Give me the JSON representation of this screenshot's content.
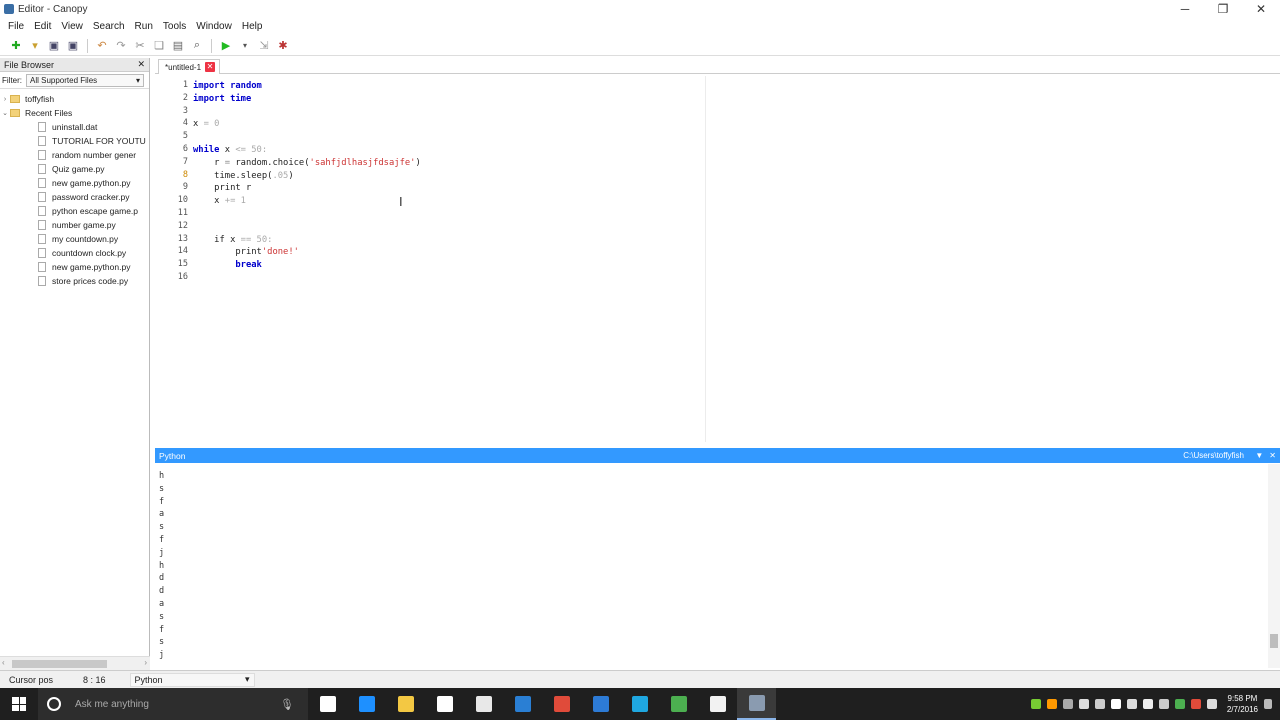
{
  "window": {
    "title": "Editor - Canopy"
  },
  "menu": [
    "File",
    "Edit",
    "View",
    "Search",
    "Run",
    "Tools",
    "Window",
    "Help"
  ],
  "file_browser": {
    "title": "File Browser",
    "filter_label": "Filter:",
    "filter_value": "All Supported Files",
    "root": "toffyfish",
    "recent_label": "Recent Files",
    "files": [
      "uninstall.dat",
      "TUTORIAL FOR YOUTU",
      "random number gener",
      "Quiz game.py",
      "new game.python.py",
      "password cracker.py",
      "python escape game.p",
      "number game.py",
      "my countdown.py",
      "countdown clock.py",
      "new game.python.py",
      "store prices code.py"
    ]
  },
  "editor": {
    "tab_label": "*untitled-1",
    "line_numbers": [
      "1",
      "2",
      "3",
      "4",
      "5",
      "6",
      "7",
      "8",
      "9",
      "10",
      "11",
      "12",
      "13",
      "14",
      "15",
      "16"
    ],
    "lines": [
      [
        {
          "t": "import",
          "c": "kw"
        },
        {
          "t": " "
        },
        {
          "t": "random",
          "c": "kw"
        }
      ],
      [
        {
          "t": "import",
          "c": "kw"
        },
        {
          "t": " "
        },
        {
          "t": "time",
          "c": "kw"
        }
      ],
      [],
      [
        {
          "t": "x "
        },
        {
          "t": "= 0",
          "c": "num"
        }
      ],
      [],
      [
        {
          "t": "while",
          "c": "kw"
        },
        {
          "t": " x "
        },
        {
          "t": "<= 50:",
          "c": "num"
        }
      ],
      [
        {
          "t": "    r "
        },
        {
          "t": "= ",
          "c": "op"
        },
        {
          "t": "random.choice("
        },
        {
          "t": "'sahfjdlhasjfdsajfe'",
          "c": "str"
        },
        {
          "t": ")"
        }
      ],
      [
        {
          "t": "    time.sleep("
        },
        {
          "t": ".05",
          "c": "num"
        },
        {
          "t": ")"
        }
      ],
      [
        {
          "t": "    print r"
        }
      ],
      [
        {
          "t": "    x "
        },
        {
          "t": "+= 1",
          "c": "num"
        }
      ],
      [],
      [],
      [
        {
          "t": "    if x "
        },
        {
          "t": "== 50:",
          "c": "num"
        }
      ],
      [
        {
          "t": "        print"
        },
        {
          "t": "'done!'",
          "c": "str"
        }
      ],
      [
        {
          "t": "        break",
          "c": "kw"
        }
      ],
      []
    ]
  },
  "python_panel": {
    "title": "Python",
    "path": "C:\\Users\\toffyfish",
    "output": [
      "h",
      "s",
      "f",
      "a",
      "s",
      "f",
      "j",
      "h",
      "d",
      "d",
      "a",
      "s",
      "f",
      "s",
      "j"
    ]
  },
  "statusbar": {
    "cursor_label": "Cursor pos",
    "cursor_value": "8 : 16",
    "language": "Python"
  },
  "taskbar": {
    "search_placeholder": "Ask me anything",
    "time": "9:58 PM",
    "date": "2/7/2016",
    "apps": [
      {
        "name": "task-view",
        "color": "#ffffff"
      },
      {
        "name": "edge",
        "color": "#1e90ff"
      },
      {
        "name": "file-explorer",
        "color": "#f3c843"
      },
      {
        "name": "store",
        "color": "#ffffff"
      },
      {
        "name": "notepad",
        "color": "#e8e8e8"
      },
      {
        "name": "outlook",
        "color": "#2a7fd4"
      },
      {
        "name": "chrome",
        "color": "#e04b3a"
      },
      {
        "name": "app-blue",
        "color": "#2d7bd6"
      },
      {
        "name": "skype",
        "color": "#1fa7e0"
      },
      {
        "name": "camtasia",
        "color": "#4caf50"
      },
      {
        "name": "app-white",
        "color": "#f2f2f2"
      },
      {
        "name": "canopy",
        "color": "#8a9bb0"
      }
    ]
  }
}
